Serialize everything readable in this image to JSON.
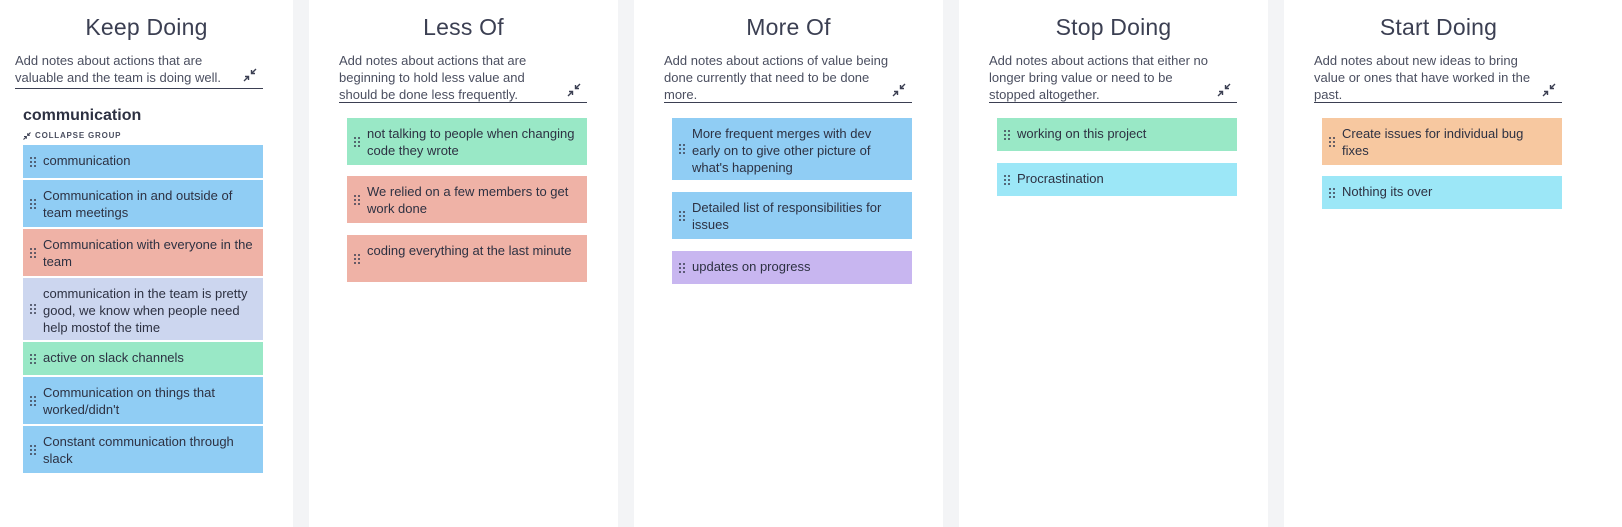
{
  "colors": {
    "blue": "#90cdf4",
    "red": "#efb2a6",
    "green": "#99e8c6",
    "lavender": "#ccd6ef",
    "purple": "#c8b6f0",
    "cyan": "#9ce7f7",
    "orange": "#f7c8a0",
    "gutter": "#f3f4f6"
  },
  "columns": [
    {
      "title": "Keep Doing",
      "description": "Add notes about actions that are valuable and the team is doing well.",
      "collapse_icon": "collapse-icon",
      "group": {
        "title": "communication",
        "collapse_label": "COLLAPSE GROUP",
        "collapse_icon": "collapse-icon"
      },
      "cards": [
        {
          "text": "communication",
          "color": "blue",
          "icon": "drag-handle-icon"
        },
        {
          "text": "Communication in and outside of team meetings",
          "color": "blue",
          "icon": "drag-handle-icon"
        },
        {
          "text": "Communication with everyone in the team",
          "color": "red",
          "icon": "drag-handle-icon"
        },
        {
          "text": "communication in the team is pretty good, we know when people need help mostof the time",
          "color": "lavender",
          "icon": "drag-handle-icon"
        },
        {
          "text": "active on slack channels",
          "color": "green",
          "icon": "drag-handle-icon"
        },
        {
          "text": "Communication on things that worked/didn't",
          "color": "blue",
          "icon": "drag-handle-icon"
        },
        {
          "text": "Constant communication through slack",
          "color": "blue",
          "icon": "drag-handle-icon"
        }
      ]
    },
    {
      "title": "Less Of",
      "description": "Add notes about actions that are beginning to hold less value and should be done less frequently.",
      "collapse_icon": "collapse-icon",
      "cards": [
        {
          "text": "not talking to people when changing code they wrote",
          "color": "green",
          "icon": "drag-handle-icon"
        },
        {
          "text": "We relied on a few members to get work done",
          "color": "red",
          "icon": "drag-handle-icon"
        },
        {
          "text": "coding everything at the last minute",
          "color": "red",
          "icon": "drag-handle-icon"
        }
      ]
    },
    {
      "title": "More Of",
      "description": "Add notes about actions of value being done currently that need to be done more.",
      "collapse_icon": "collapse-icon",
      "cards": [
        {
          "text": "More frequent merges with dev early on to give other picture of what's happening",
          "color": "blue",
          "icon": "drag-handle-icon"
        },
        {
          "text": "Detailed list of responsibilities for issues",
          "color": "blue",
          "icon": "drag-handle-icon"
        },
        {
          "text": "updates on progress",
          "color": "purple",
          "icon": "drag-handle-icon"
        }
      ]
    },
    {
      "title": "Stop Doing",
      "description": "Add notes about actions that either no longer bring value or need to be stopped altogether.",
      "collapse_icon": "collapse-icon",
      "cards": [
        {
          "text": "working on this project",
          "color": "green",
          "icon": "drag-handle-icon"
        },
        {
          "text": "Procrastination",
          "color": "cyan",
          "icon": "drag-handle-icon"
        }
      ]
    },
    {
      "title": "Start Doing",
      "description": "Add notes about new ideas to bring value or ones that have worked in the past.",
      "collapse_icon": "collapse-icon",
      "cards": [
        {
          "text": "Create issues for individual bug fixes",
          "color": "orange",
          "icon": "drag-handle-icon"
        },
        {
          "text": "Nothing its over",
          "color": "cyan",
          "icon": "drag-handle-icon"
        }
      ]
    }
  ]
}
